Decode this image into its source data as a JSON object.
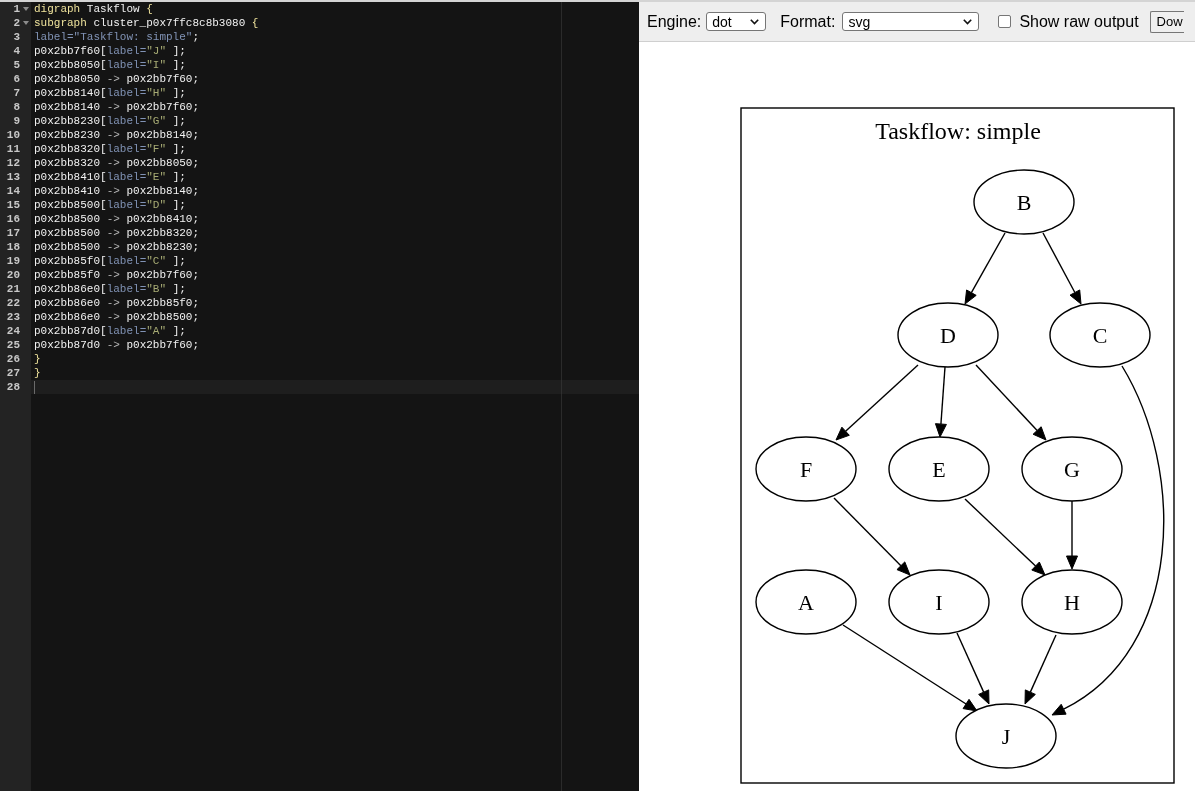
{
  "editor": {
    "lines": [
      {
        "number": "1",
        "foldable": true,
        "active": false,
        "tokens": [
          {
            "kind": "keyword",
            "text": "digraph"
          },
          {
            "kind": "plain",
            "text": " Taskflow "
          },
          {
            "kind": "brace",
            "text": "{"
          }
        ]
      },
      {
        "number": "2",
        "foldable": true,
        "active": false,
        "tokens": [
          {
            "kind": "keyword",
            "text": "subgraph"
          },
          {
            "kind": "plain",
            "text": " cluster_p0x7ffc8c8b3080 "
          },
          {
            "kind": "brace",
            "text": "{"
          }
        ]
      },
      {
        "number": "3",
        "foldable": false,
        "active": false,
        "tokens": [
          {
            "kind": "attribute",
            "text": "label=\"Taskflow: simple\""
          },
          {
            "kind": "plain",
            "text": ";"
          }
        ]
      },
      {
        "number": "4",
        "foldable": false,
        "active": false,
        "tokens": [
          {
            "kind": "plain",
            "text": "p0x2bb7f60["
          },
          {
            "kind": "attribute",
            "text": "label="
          },
          {
            "kind": "string",
            "text": "\"J\""
          },
          {
            "kind": "plain",
            "text": " ];"
          }
        ]
      },
      {
        "number": "5",
        "foldable": false,
        "active": false,
        "tokens": [
          {
            "kind": "plain",
            "text": "p0x2bb8050["
          },
          {
            "kind": "attribute",
            "text": "label="
          },
          {
            "kind": "string",
            "text": "\"I\""
          },
          {
            "kind": "plain",
            "text": " ];"
          }
        ]
      },
      {
        "number": "6",
        "foldable": false,
        "active": false,
        "tokens": [
          {
            "kind": "plain",
            "text": "p0x2bb8050 "
          },
          {
            "kind": "operator",
            "text": "->"
          },
          {
            "kind": "plain",
            "text": " p0x2bb7f60;"
          }
        ]
      },
      {
        "number": "7",
        "foldable": false,
        "active": false,
        "tokens": [
          {
            "kind": "plain",
            "text": "p0x2bb8140["
          },
          {
            "kind": "attribute",
            "text": "label="
          },
          {
            "kind": "string",
            "text": "\"H\""
          },
          {
            "kind": "plain",
            "text": " ];"
          }
        ]
      },
      {
        "number": "8",
        "foldable": false,
        "active": false,
        "tokens": [
          {
            "kind": "plain",
            "text": "p0x2bb8140 "
          },
          {
            "kind": "operator",
            "text": "->"
          },
          {
            "kind": "plain",
            "text": " p0x2bb7f60;"
          }
        ]
      },
      {
        "number": "9",
        "foldable": false,
        "active": false,
        "tokens": [
          {
            "kind": "plain",
            "text": "p0x2bb8230["
          },
          {
            "kind": "attribute",
            "text": "label="
          },
          {
            "kind": "string",
            "text": "\"G\""
          },
          {
            "kind": "plain",
            "text": " ];"
          }
        ]
      },
      {
        "number": "10",
        "foldable": false,
        "active": false,
        "tokens": [
          {
            "kind": "plain",
            "text": "p0x2bb8230 "
          },
          {
            "kind": "operator",
            "text": "->"
          },
          {
            "kind": "plain",
            "text": " p0x2bb8140;"
          }
        ]
      },
      {
        "number": "11",
        "foldable": false,
        "active": false,
        "tokens": [
          {
            "kind": "plain",
            "text": "p0x2bb8320["
          },
          {
            "kind": "attribute",
            "text": "label="
          },
          {
            "kind": "string",
            "text": "\"F\""
          },
          {
            "kind": "plain",
            "text": " ];"
          }
        ]
      },
      {
        "number": "12",
        "foldable": false,
        "active": false,
        "tokens": [
          {
            "kind": "plain",
            "text": "p0x2bb8320 "
          },
          {
            "kind": "operator",
            "text": "->"
          },
          {
            "kind": "plain",
            "text": " p0x2bb8050;"
          }
        ]
      },
      {
        "number": "13",
        "foldable": false,
        "active": false,
        "tokens": [
          {
            "kind": "plain",
            "text": "p0x2bb8410["
          },
          {
            "kind": "attribute",
            "text": "label="
          },
          {
            "kind": "string",
            "text": "\"E\""
          },
          {
            "kind": "plain",
            "text": " ];"
          }
        ]
      },
      {
        "number": "14",
        "foldable": false,
        "active": false,
        "tokens": [
          {
            "kind": "plain",
            "text": "p0x2bb8410 "
          },
          {
            "kind": "operator",
            "text": "->"
          },
          {
            "kind": "plain",
            "text": " p0x2bb8140;"
          }
        ]
      },
      {
        "number": "15",
        "foldable": false,
        "active": false,
        "tokens": [
          {
            "kind": "plain",
            "text": "p0x2bb8500["
          },
          {
            "kind": "attribute",
            "text": "label="
          },
          {
            "kind": "string",
            "text": "\"D\""
          },
          {
            "kind": "plain",
            "text": " ];"
          }
        ]
      },
      {
        "number": "16",
        "foldable": false,
        "active": false,
        "tokens": [
          {
            "kind": "plain",
            "text": "p0x2bb8500 "
          },
          {
            "kind": "operator",
            "text": "->"
          },
          {
            "kind": "plain",
            "text": " p0x2bb8410;"
          }
        ]
      },
      {
        "number": "17",
        "foldable": false,
        "active": false,
        "tokens": [
          {
            "kind": "plain",
            "text": "p0x2bb8500 "
          },
          {
            "kind": "operator",
            "text": "->"
          },
          {
            "kind": "plain",
            "text": " p0x2bb8320;"
          }
        ]
      },
      {
        "number": "18",
        "foldable": false,
        "active": false,
        "tokens": [
          {
            "kind": "plain",
            "text": "p0x2bb8500 "
          },
          {
            "kind": "operator",
            "text": "->"
          },
          {
            "kind": "plain",
            "text": " p0x2bb8230;"
          }
        ]
      },
      {
        "number": "19",
        "foldable": false,
        "active": false,
        "tokens": [
          {
            "kind": "plain",
            "text": "p0x2bb85f0["
          },
          {
            "kind": "attribute",
            "text": "label="
          },
          {
            "kind": "string",
            "text": "\"C\""
          },
          {
            "kind": "plain",
            "text": " ];"
          }
        ]
      },
      {
        "number": "20",
        "foldable": false,
        "active": false,
        "tokens": [
          {
            "kind": "plain",
            "text": "p0x2bb85f0 "
          },
          {
            "kind": "operator",
            "text": "->"
          },
          {
            "kind": "plain",
            "text": " p0x2bb7f60;"
          }
        ]
      },
      {
        "number": "21",
        "foldable": false,
        "active": false,
        "tokens": [
          {
            "kind": "plain",
            "text": "p0x2bb86e0["
          },
          {
            "kind": "attribute",
            "text": "label="
          },
          {
            "kind": "string",
            "text": "\"B\""
          },
          {
            "kind": "plain",
            "text": " ];"
          }
        ]
      },
      {
        "number": "22",
        "foldable": false,
        "active": false,
        "tokens": [
          {
            "kind": "plain",
            "text": "p0x2bb86e0 "
          },
          {
            "kind": "operator",
            "text": "->"
          },
          {
            "kind": "plain",
            "text": " p0x2bb85f0;"
          }
        ]
      },
      {
        "number": "23",
        "foldable": false,
        "active": false,
        "tokens": [
          {
            "kind": "plain",
            "text": "p0x2bb86e0 "
          },
          {
            "kind": "operator",
            "text": "->"
          },
          {
            "kind": "plain",
            "text": " p0x2bb8500;"
          }
        ]
      },
      {
        "number": "24",
        "foldable": false,
        "active": false,
        "tokens": [
          {
            "kind": "plain",
            "text": "p0x2bb87d0["
          },
          {
            "kind": "attribute",
            "text": "label="
          },
          {
            "kind": "string",
            "text": "\"A\""
          },
          {
            "kind": "plain",
            "text": " ];"
          }
        ]
      },
      {
        "number": "25",
        "foldable": false,
        "active": false,
        "tokens": [
          {
            "kind": "plain",
            "text": "p0x2bb87d0 "
          },
          {
            "kind": "operator",
            "text": "->"
          },
          {
            "kind": "plain",
            "text": " p0x2bb7f60;"
          }
        ]
      },
      {
        "number": "26",
        "foldable": false,
        "active": false,
        "tokens": [
          {
            "kind": "brace",
            "text": "}"
          }
        ]
      },
      {
        "number": "27",
        "foldable": false,
        "active": false,
        "tokens": [
          {
            "kind": "brace",
            "text": "}"
          }
        ]
      },
      {
        "number": "28",
        "foldable": false,
        "active": true
      }
    ]
  },
  "toolbar": {
    "engine": {
      "label": "Engine:",
      "value": "dot"
    },
    "format": {
      "label": "Format:",
      "value": "svg"
    },
    "raw_output": {
      "label": "Show raw output",
      "checked": false
    },
    "button": {
      "label": "Dow"
    }
  },
  "graph": {
    "title": "Taskflow: simple",
    "nodes": [
      {
        "label": "B"
      },
      {
        "label": "D"
      },
      {
        "label": "C"
      },
      {
        "label": "F"
      },
      {
        "label": "E"
      },
      {
        "label": "G"
      },
      {
        "label": "A"
      },
      {
        "label": "I"
      },
      {
        "label": "H"
      },
      {
        "label": "J"
      }
    ]
  }
}
